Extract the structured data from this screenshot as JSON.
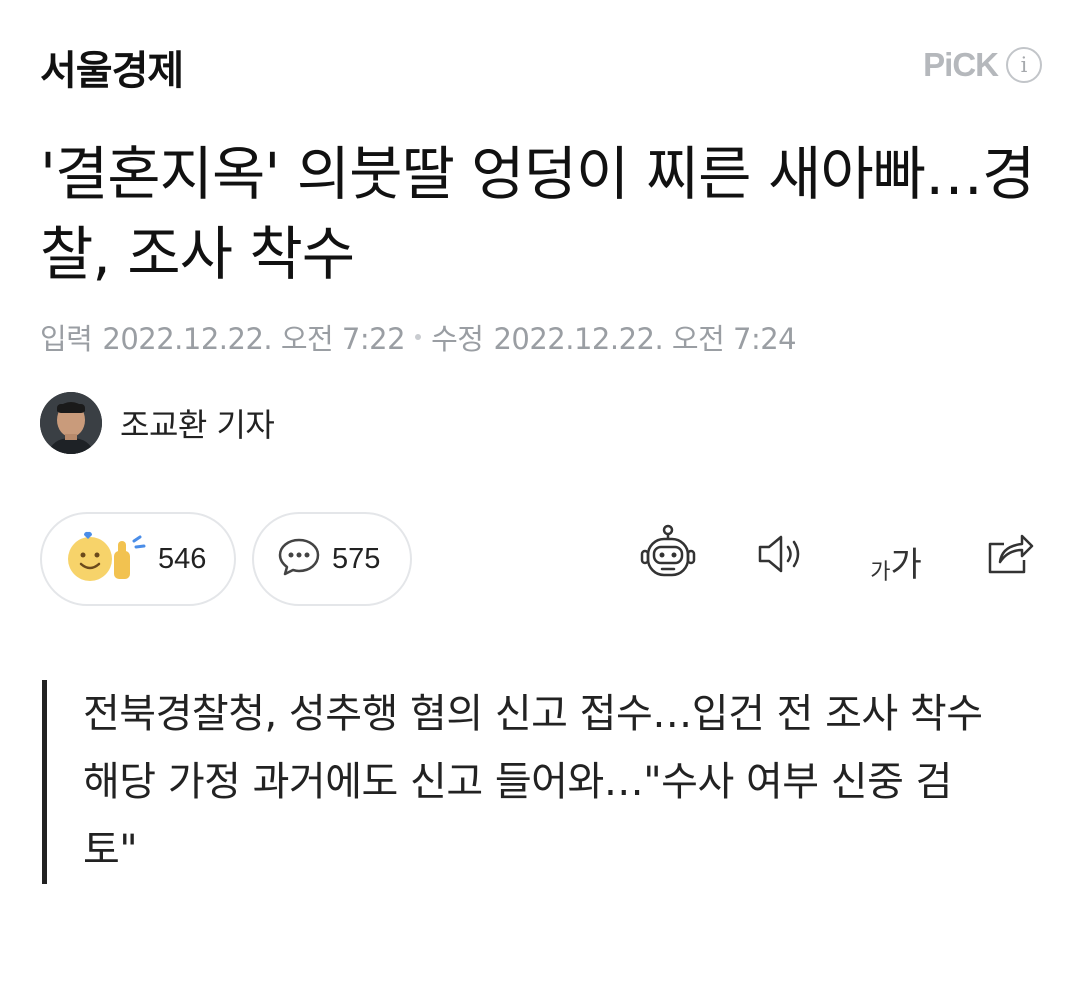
{
  "header": {
    "press_name": "서울경제",
    "pick_label": "PiCK",
    "info_icon": "i"
  },
  "article": {
    "title": "'결혼지옥' 의붓딸 엉덩이 찌른 새아빠…경찰, 조사 착수",
    "input_label": "입력",
    "input_time": "2022.12.22. 오전 7:22",
    "modified_label": "수정",
    "modified_time": "2022.12.22. 오전 7:24",
    "reporter": "조교환 기자"
  },
  "reactions": {
    "like_count": "546",
    "comment_count": "575"
  },
  "tools": {
    "font_small": "가",
    "font_big": "가"
  },
  "summary": {
    "lines": [
      "전북경찰청, 성추행 혐의 신고 접수…입건 전 조사 착수",
      "해당 가정 과거에도 신고 들어와…\"수사 여부 신중 검토\""
    ]
  },
  "colors": {
    "text": "#111111",
    "meta": "#9a9ea3",
    "pick": "#b5b8bc",
    "border": "#e4e6e9"
  }
}
